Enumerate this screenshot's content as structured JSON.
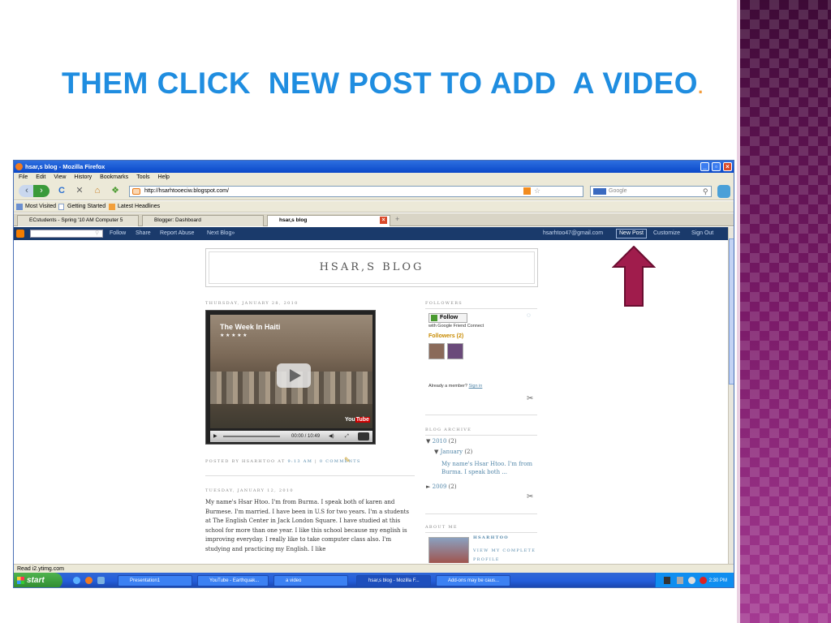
{
  "slide": {
    "title": "THEM CLICK  NEW POST TO ADD  A VIDEO",
    "title_dot": ".",
    "colors": {
      "title": "#1f8de0",
      "accent": "#f29c3c",
      "arrow": "#a01c4c",
      "deco": "#6a1458"
    }
  },
  "browser": {
    "window_title": "hsar,s blog - Mozilla Firefox",
    "menu": [
      "File",
      "Edit",
      "View",
      "History",
      "Bookmarks",
      "Tools",
      "Help"
    ],
    "url": "http://hsarhtooeciw.blogspot.com/",
    "search_placeholder": "Google",
    "bookmarks": [
      "Most Visited",
      "Getting Started",
      "Latest Headlines"
    ],
    "tabs": [
      {
        "label": "ECstudents - Spring '10 AM Computer 5"
      },
      {
        "label": "Blogger: Dashboard"
      },
      {
        "label": "hsar,s blog"
      }
    ],
    "status": "Read i2.ytimg.com"
  },
  "blogger_bar": {
    "links": [
      "Follow",
      "Share",
      "Report Abuse",
      "Next Blog»"
    ],
    "email": "hsarhtoo47@gmail.com",
    "new_post": "New Post",
    "customize": "Customize",
    "sign_out": "Sign Out"
  },
  "blog": {
    "title": "HSAR,S BLOG",
    "post1_date": "THURSDAY, JANUARY 28, 2010",
    "video_title": "The Week In Haiti",
    "video_stars": "★ ★ ★ ★ ★",
    "video_time": "00:00 / 10:49",
    "posted_by": "POSTED BY HSARHTOO AT",
    "post_time": "9:13 AM",
    "comments": "0 COMMENTS",
    "post2_date": "TUESDAY, JANUARY 12, 2010",
    "post2_text": "My name's Hsar Htoo. I'm from Burma. I speak both of karen and Burmese. I'm married. I have been in U.S for two years. I'm a students at The English Center in Jack London Square. I have studied at this school for more than one year. I like this school because my english is improving everyday. I really like to take computer class also. I'm studying and practicing my English. I like"
  },
  "sidebar": {
    "followers_heading": "FOLLOWERS",
    "follow_label": "Follow",
    "gfc": "with Google Friend Connect",
    "followers_count": "Followers (2)",
    "member": "Already a member?",
    "sign_in": "Sign in",
    "archive_heading": "BLOG ARCHIVE",
    "archive_year": "2010",
    "archive_year_count": "(2)",
    "archive_month": "January",
    "archive_month_count": "(2)",
    "archive_post": "My name's Hsar Htoo. I'm from Burma. I speak both ...",
    "archive_prev": "2009",
    "archive_prev_count": "(2)",
    "about_heading": "ABOUT ME",
    "author": "HSARHTOO",
    "profile": "VIEW MY COMPLETE PROFILE"
  },
  "taskbar": {
    "start": "start",
    "items": [
      "Presentation1",
      "YouTube - Earthquak...",
      "a video",
      "hsar,s blog - Mozilla F...",
      "Add-ons may be caus..."
    ],
    "clock": "2:30 PM"
  }
}
